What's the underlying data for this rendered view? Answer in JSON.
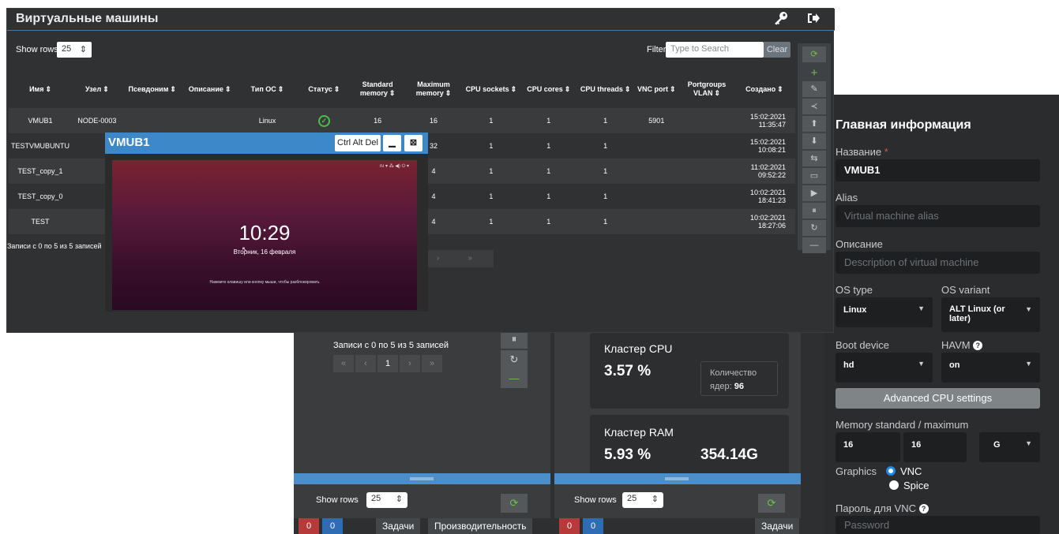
{
  "header": {
    "title": "Виртуальные машины",
    "key_icon": "key-icon",
    "logout_icon": "logout-icon"
  },
  "controls": {
    "show_rows_label": "Show rows",
    "show_rows_value": "25",
    "filter_label": "Filter",
    "filter_placeholder": "Type to Search",
    "clear_label": "Clear"
  },
  "table": {
    "columns": [
      "Имя",
      "Узел",
      "Псевдоним",
      "Описание",
      "Тип ОС",
      "Статус",
      "Standard memory",
      "Maximum memory",
      "CPU sockets",
      "CPU cores",
      "CPU threads",
      "VNC port",
      "Portgroups VLAN",
      "Создано"
    ],
    "rows": [
      [
        "VMUB1",
        "NODE-0003",
        "",
        "",
        "Linux",
        "ok",
        "16",
        "16",
        "1",
        "1",
        "1",
        "5901",
        "",
        "15:02:2021 11:35:47"
      ],
      [
        "TESTVMUBUNTU",
        "",
        "",
        "",
        "",
        "",
        "",
        "32",
        "1",
        "1",
        "1",
        "",
        "",
        "15:02:2021 10:08:21"
      ],
      [
        "TEST_copy_1",
        "",
        "",
        "",
        "",
        "",
        "",
        "4",
        "1",
        "1",
        "1",
        "",
        "",
        "11:02:2021 09:52:22"
      ],
      [
        "TEST_copy_0",
        "",
        "",
        "",
        "",
        "",
        "",
        "4",
        "1",
        "1",
        "1",
        "",
        "",
        "10:02:2021 18:41:23"
      ],
      [
        "TEST",
        "",
        "",
        "",
        "",
        "",
        "",
        "4",
        "1",
        "1",
        "1",
        "",
        "",
        "10:02:2021 18:27:06"
      ]
    ],
    "footer": "Записи с 0 по 5 из 5 записей"
  },
  "vnc": {
    "title": "VMUB1",
    "ctrl_alt_del": "Ctrl Alt Del",
    "clock": "10:29",
    "date": "Вторник, 16 февраля",
    "hint": "Нажмите клавишу или кнопку мыши, чтобы разблокировать",
    "tray": "ru ▾   ⁂ ◀) ⏻ ▾"
  },
  "back": {
    "pager_text": "Записи с 0 по 5 из 5 записей",
    "pager": [
      "«",
      "‹",
      "1",
      "›",
      "»"
    ],
    "cpu_card": {
      "title": "Кластер CPU",
      "value": "3.57 %",
      "cores_label": "Количество ядер:",
      "cores_value": "96"
    },
    "ram_card": {
      "title": "Кластер RAM",
      "value": "5.93 %",
      "total": "354.14G"
    },
    "show_rows_label": "Show rows",
    "show_rows_value": "25",
    "counters": [
      "0",
      "0"
    ],
    "tabs": [
      "Задачи",
      "Производительность"
    ],
    "tab_right": "Задачи"
  },
  "form": {
    "title": "Главная информация",
    "name_label": "Название",
    "name_value": "VMUB1",
    "alias_label": "Alias",
    "alias_placeholder": "Virtual machine alias",
    "desc_label": "Описание",
    "desc_placeholder": "Description of virtual machine",
    "ostype_label": "OS type",
    "ostype_value": "Linux",
    "osvariant_label": "OS variant",
    "osvariant_value": "ALT Linux (or later)",
    "boot_label": "Boot device",
    "boot_value": "hd",
    "havm_label": "HAVM",
    "havm_value": "on",
    "adv_cpu_label": "Advanced CPU settings",
    "memory_label": "Memory standard / maximum",
    "mem_std": "16",
    "mem_max": "16",
    "mem_unit": "G",
    "graphics_label": "Graphics",
    "vnc_label": "VNC",
    "spice_label": "Spice",
    "vncpass_label": "Пароль для VNC",
    "password_placeholder": "Password",
    "accent": "#1e88e5"
  }
}
